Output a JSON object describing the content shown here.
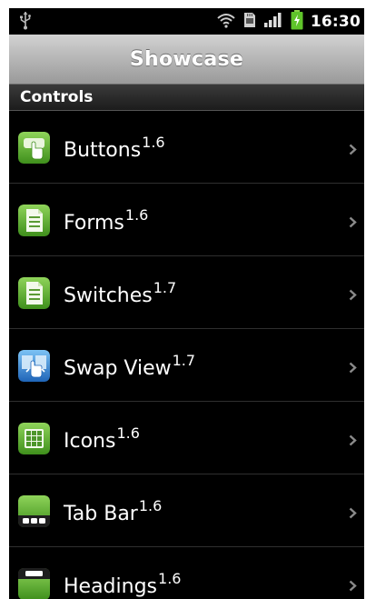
{
  "status_bar": {
    "time": "16:30",
    "icons": [
      "usb-icon",
      "wifi-icon",
      "sd-card-icon",
      "signal-icon",
      "battery-charging-icon"
    ]
  },
  "title_bar": {
    "title": "Showcase"
  },
  "section": {
    "label": "Controls"
  },
  "items": [
    {
      "label": "Buttons",
      "version": "1.6",
      "icon": "buttons-icon"
    },
    {
      "label": "Forms",
      "version": "1.6",
      "icon": "forms-icon"
    },
    {
      "label": "Switches",
      "version": "1.7",
      "icon": "switches-icon"
    },
    {
      "label": "Swap View",
      "version": "1.7",
      "icon": "swap-view-icon"
    },
    {
      "label": "Icons",
      "version": "1.6",
      "icon": "icons-grid-icon"
    },
    {
      "label": "Tab Bar",
      "version": "1.6",
      "icon": "tab-bar-icon"
    },
    {
      "label": "Headings",
      "version": "1.6",
      "icon": "headings-icon"
    }
  ],
  "colors": {
    "background": "#000000",
    "accent_green": "#5fae2d",
    "accent_blue": "#2a7fd4",
    "title_bar_top": "#d2d2d2",
    "title_bar_bottom": "#9a9a9a"
  }
}
